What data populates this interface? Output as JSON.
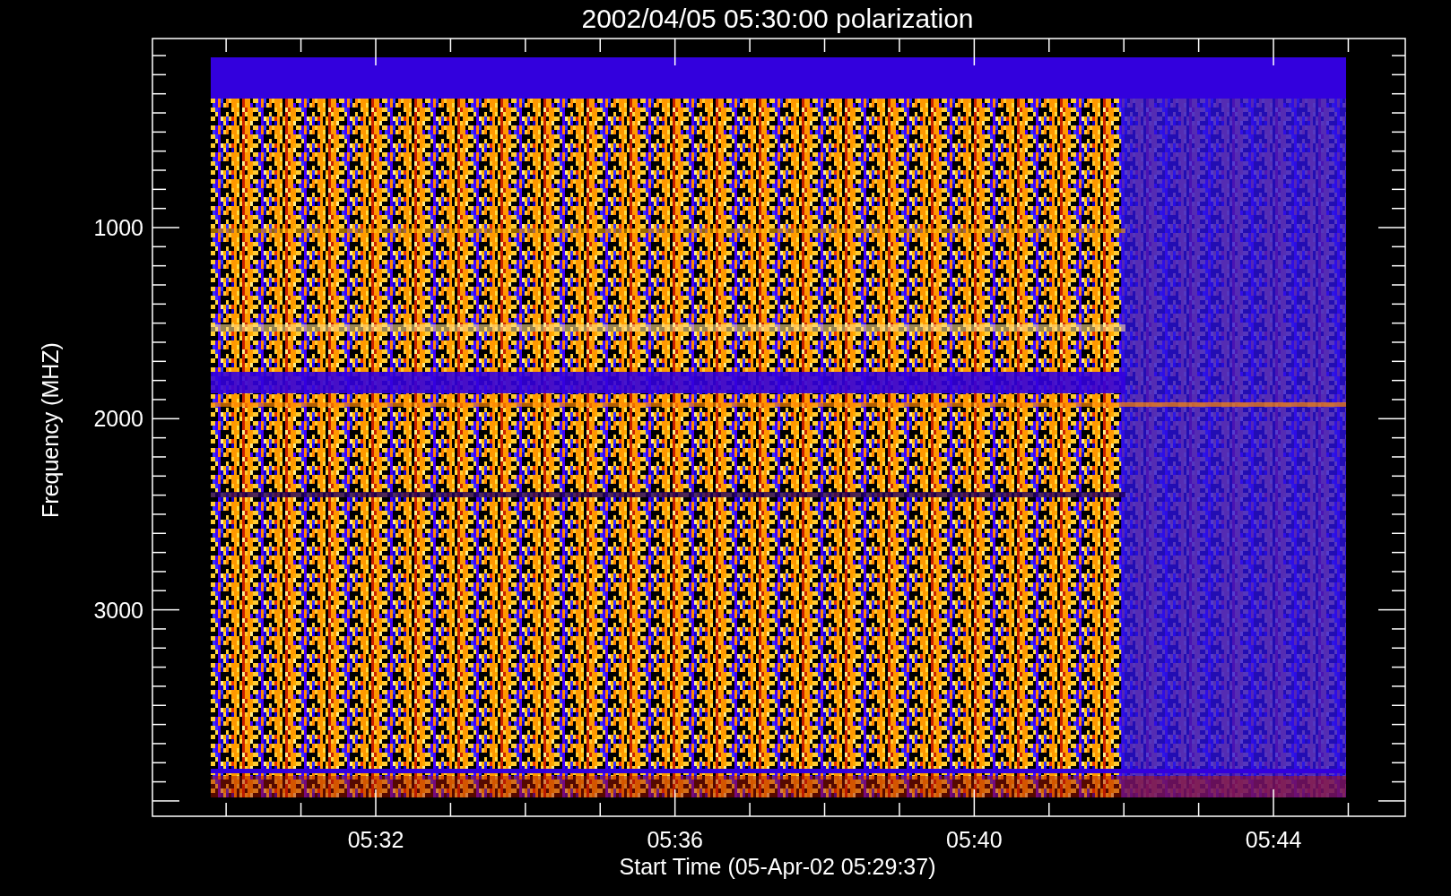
{
  "title": "2002/04/05 05:30:00 polarization",
  "y_axis": {
    "label": "Frequency (MHZ)",
    "ticks": [
      "1000",
      "2000",
      "3000"
    ]
  },
  "x_axis": {
    "label": "Start Time (05-Apr-02 05:29:37)",
    "ticks": [
      "05:32",
      "05:36",
      "05:40",
      "05:44"
    ]
  }
}
